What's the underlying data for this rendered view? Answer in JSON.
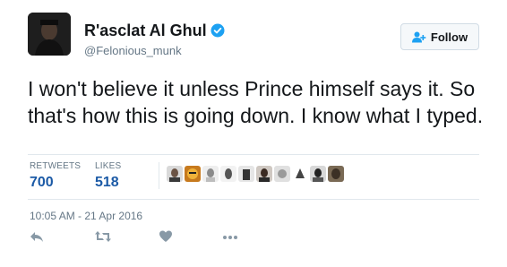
{
  "user": {
    "display_name": "R'asclat Al Ghul",
    "handle": "@Felonious_munk",
    "verified": true
  },
  "follow_button": {
    "label": "Follow"
  },
  "tweet": {
    "text": "I won't believe it unless Prince himself says it. So that's how this is going down. I know what I typed."
  },
  "stats": {
    "retweets_label": "RETWEETS",
    "retweets_value": "700",
    "likes_label": "LIKES",
    "likes_value": "518"
  },
  "likers_count_shown": 10,
  "timestamp": "10:05 AM - 21 Apr 2016",
  "actions": [
    "reply-icon",
    "retweet-icon",
    "like-icon",
    "more-icon"
  ],
  "colors": {
    "accent": "#1da1f2",
    "stat_value": "#1b5aa6",
    "muted": "#657786"
  }
}
